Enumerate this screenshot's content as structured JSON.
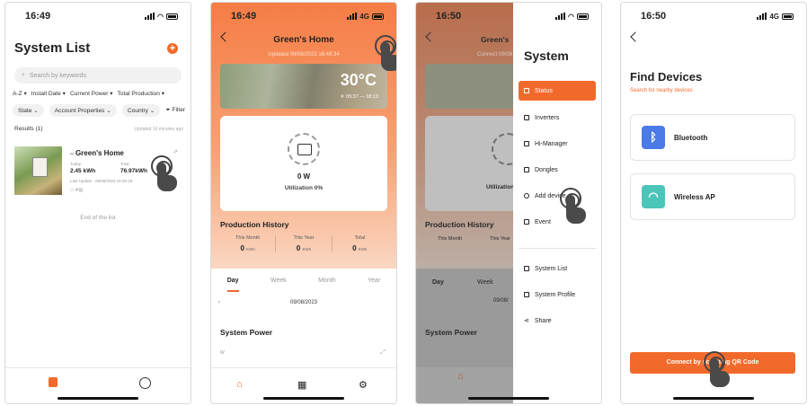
{
  "time1": "16:49",
  "time2": "16:49",
  "time3": "16:50",
  "time4": "16:50",
  "net": "4G",
  "colors": {
    "accent": "#f26a2b"
  },
  "screen1": {
    "title": "System List",
    "search_placeholder": "Search by keywords",
    "sort_options": [
      "A-Z",
      "Install Date",
      "Current Power",
      "Total Production"
    ],
    "filter_chips": [
      "State",
      "Account Properties",
      "Country"
    ],
    "filter_label": "Filter",
    "results_label": "Results (1)",
    "updated_text": "Updated 16 minutes ago",
    "system": {
      "name": "Green's Home",
      "today_label": "Today",
      "today_value": "2.45 kWh",
      "total_label": "Total",
      "total_value": "76.97kWh",
      "last_update": "Last Update : 09/08/2023 16:00:18",
      "owner": "中国"
    },
    "end_text": "End of the list"
  },
  "screen2": {
    "title": "Green's Home",
    "updated": "Updated 09/08/2023 16:49:34",
    "temperature": "30°C",
    "sun_times": "05:37 — 18:13",
    "power": "0 W",
    "utilization": "Utilization 0%",
    "production_title": "Production History",
    "production": [
      {
        "label": "This Month",
        "value": "0",
        "unit": "KWh"
      },
      {
        "label": "This Year",
        "value": "0",
        "unit": "KWh"
      },
      {
        "label": "Total",
        "value": "0",
        "unit": "KWh"
      }
    ],
    "tabs": [
      "Day",
      "Week",
      "Month",
      "Year"
    ],
    "date": "09/08/2023",
    "power_title": "System Power",
    "power_unit": "W"
  },
  "screen3": {
    "bg_title": "Green's",
    "bg_updated": "Connect 09/08",
    "bg_util": "Utilization",
    "bg_prod": "Production History",
    "bg_this_month": "This Month",
    "bg_this_year": "This Year",
    "bg_day": "Day",
    "bg_week": "Week",
    "bg_date": "09/08/",
    "bg_power": "System Power",
    "drawer_title": "System",
    "menu": [
      "Status",
      "Inverters",
      "Hi-Manager",
      "Dongles",
      "Add device",
      "Event"
    ],
    "menu2": [
      "System List",
      "System Profile",
      "Share"
    ]
  },
  "screen4": {
    "title": "Find Devices",
    "subtitle": "Search for nearby devices",
    "devices": [
      "Bluetooth",
      "Wireless AP"
    ],
    "qr_button": "Connect by scanning QR Code"
  }
}
